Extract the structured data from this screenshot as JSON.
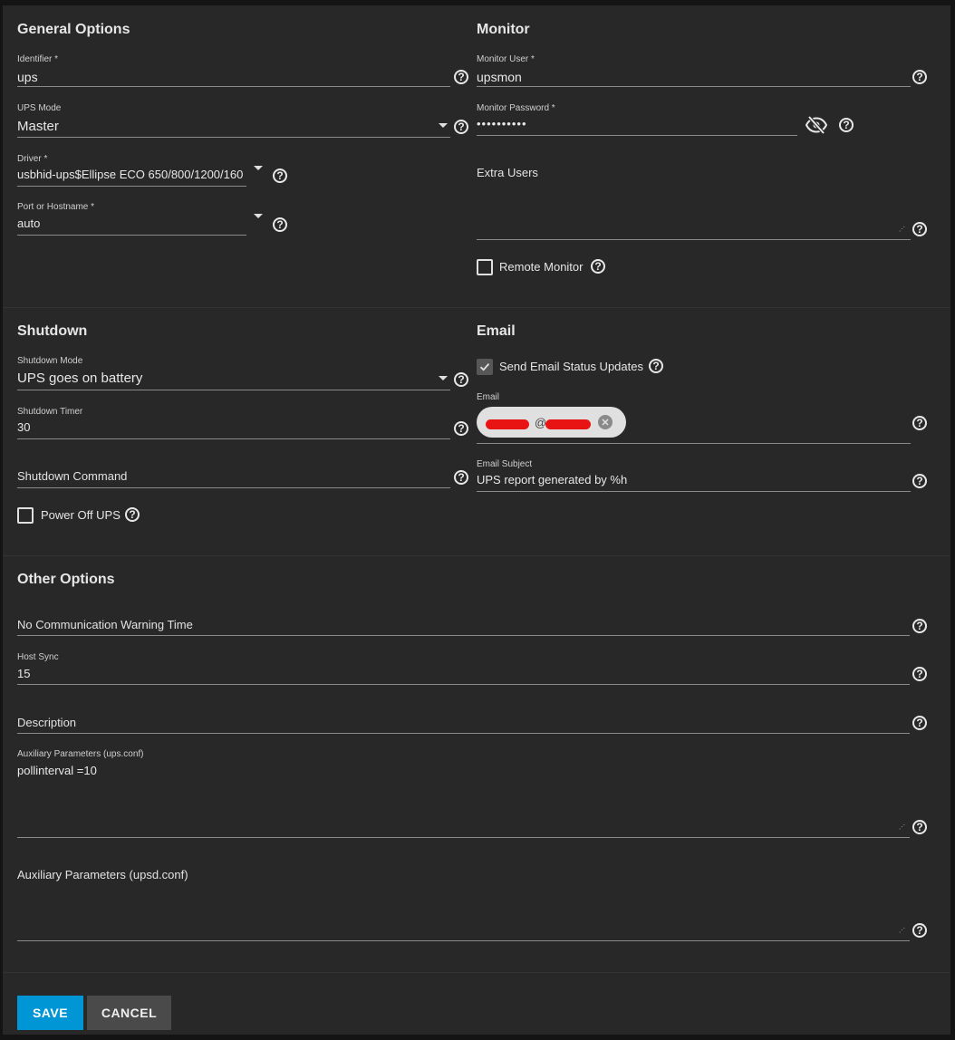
{
  "general": {
    "title": "General Options",
    "identifier": {
      "label": "Identifier *",
      "value": "ups"
    },
    "ups_mode": {
      "label": "UPS Mode",
      "value": "Master"
    },
    "driver": {
      "label": "Driver *",
      "value": "usbhid-ups$Ellipse ECO 650/800/1200/160"
    },
    "port": {
      "label": "Port or Hostname *",
      "value": "auto"
    }
  },
  "monitor": {
    "title": "Monitor",
    "user": {
      "label": "Monitor User *",
      "value": "upsmon"
    },
    "password": {
      "label": "Monitor Password *",
      "value": "••••••••••"
    },
    "extra_users": {
      "placeholder": "Extra Users",
      "value": ""
    },
    "remote_monitor": {
      "label": "Remote Monitor",
      "checked": false
    }
  },
  "shutdown": {
    "title": "Shutdown",
    "mode": {
      "label": "Shutdown Mode",
      "value": "UPS goes on battery"
    },
    "timer": {
      "label": "Shutdown Timer",
      "value": "30"
    },
    "command": {
      "placeholder": "Shutdown Command",
      "value": ""
    },
    "power_off": {
      "label": "Power Off UPS",
      "checked": false
    }
  },
  "email": {
    "title": "Email",
    "send_updates": {
      "label": "Send Email Status Updates",
      "checked": true
    },
    "email": {
      "label": "Email",
      "chip": "@"
    },
    "subject": {
      "label": "Email Subject",
      "value": "UPS report generated by %h"
    }
  },
  "other": {
    "title": "Other Options",
    "no_comm": {
      "placeholder": "No Communication Warning Time",
      "value": ""
    },
    "host_sync": {
      "label": "Host Sync",
      "value": "15"
    },
    "description": {
      "placeholder": "Description",
      "value": ""
    },
    "aux_ups": {
      "label": "Auxiliary Parameters (ups.conf)",
      "value": "pollinterval =10"
    },
    "aux_upsd": {
      "placeholder": "Auxiliary Parameters (upsd.conf)",
      "value": ""
    }
  },
  "actions": {
    "save": "SAVE",
    "cancel": "CANCEL"
  },
  "colors": {
    "primary": "#0095d5",
    "background": "#282828",
    "page": "#141414"
  },
  "icons": {
    "help": "help-circle-icon",
    "visibility": "eye-off-icon",
    "dropdown": "arrow-drop-down-icon",
    "check": "check-icon",
    "close": "close-circle-icon"
  }
}
